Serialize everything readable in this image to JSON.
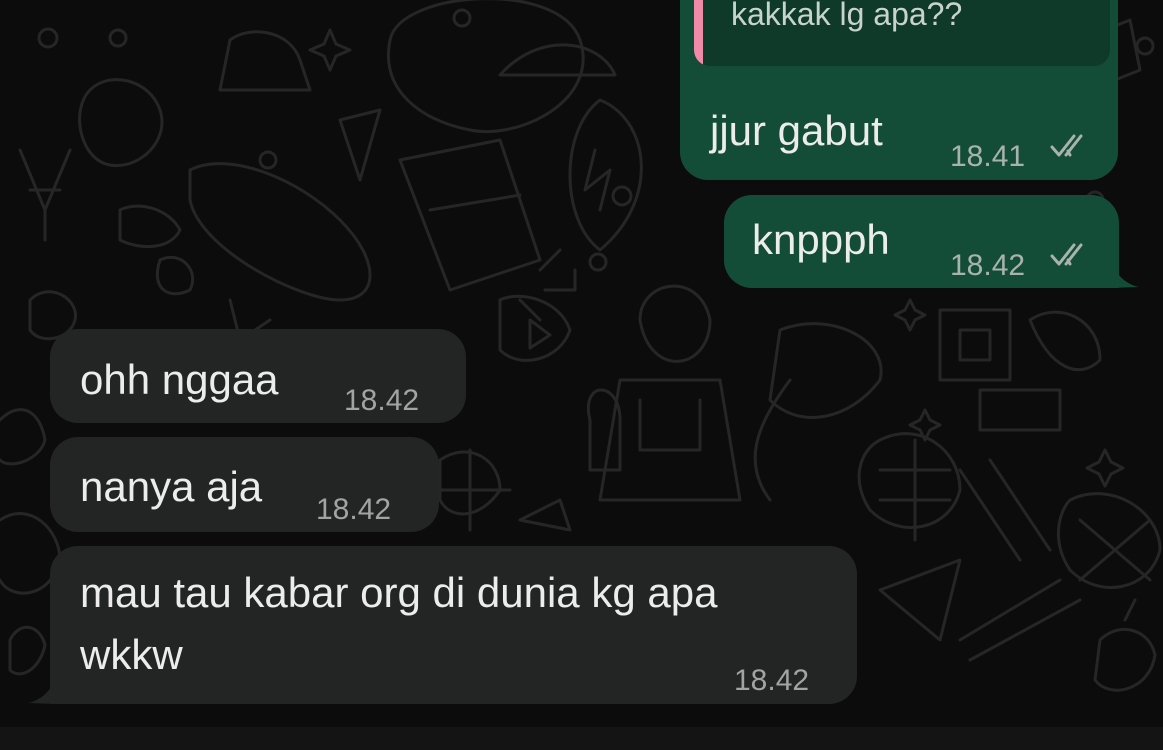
{
  "chat": {
    "messages": [
      {
        "id": "m1",
        "direction": "outgoing",
        "quoted_text": "kakkak lg apa??",
        "text": "jjur gabut",
        "time": "18.41",
        "status": "read"
      },
      {
        "id": "m2",
        "direction": "outgoing",
        "text": "knppph",
        "time": "18.42",
        "status": "read"
      },
      {
        "id": "m3",
        "direction": "incoming",
        "text": "ohh nggaa",
        "time": "18.42"
      },
      {
        "id": "m4",
        "direction": "incoming",
        "text": "nanya aja",
        "time": "18.42"
      },
      {
        "id": "m5",
        "direction": "incoming",
        "text_lines": [
          "mau tau kabar org di dunia kg apa",
          "wkkw"
        ],
        "time": "18.42"
      }
    ]
  },
  "colors": {
    "background": "#0c0c0c",
    "outgoing_bubble": "#144d37",
    "incoming_bubble": "#232424",
    "quote_bar": "#ef8aa8"
  },
  "icons": {
    "read_receipt": "double-check-icon",
    "wallpaper": "doodle-pattern"
  }
}
